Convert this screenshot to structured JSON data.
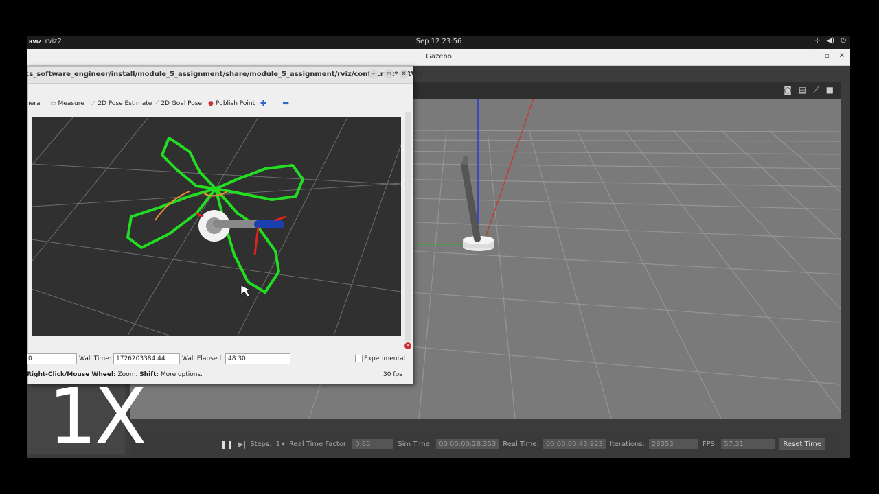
{
  "topbar": {
    "app_icon": "RVIZ",
    "app": "rviz2",
    "clock": "Sep 12  23:56",
    "tray_icons": [
      "network-icon",
      "volume-icon",
      "power-icon"
    ]
  },
  "gazebo": {
    "title": "Gazebo",
    "bottom": {
      "steps_label": "Steps:",
      "steps_value": "1",
      "rtf_label": "Real Time Factor:",
      "rtf_value": "0.65",
      "sim_label": "Sim Time:",
      "sim_value": "00 00:00:28.353",
      "real_label": "Real Time:",
      "real_value": "00 00:00:43.923",
      "iter_label": "Iterations:",
      "iter_value": "28353",
      "fps_label": "FPS:",
      "fps_value": "57.31",
      "reset_label": "Reset Time"
    }
  },
  "rviz": {
    "title": "ics_software_engineer/install/module_5_assignment/share/module_5_assignment/rviz/config.rviz* - RViz",
    "tools": {
      "camera": "mera",
      "measure": "Measure",
      "pose": "2D Pose Estimate",
      "goal": "2D Goal Pose",
      "publish": "Publish Point"
    },
    "status": {
      "first_value": "0",
      "wall_time_label": "Wall Time:",
      "wall_time_value": "1726203384.44",
      "wall_elapsed_label": "Wall Elapsed:",
      "wall_elapsed_value": "48.30",
      "experimental": "Experimental",
      "hint_bold": "Right-Click/Mouse Wheel:",
      "hint_zoom": " Zoom. ",
      "hint_shift": "Shift:",
      "hint_more": " More options.",
      "fps": "30 fps"
    }
  },
  "overlay": {
    "speed": "1X"
  }
}
